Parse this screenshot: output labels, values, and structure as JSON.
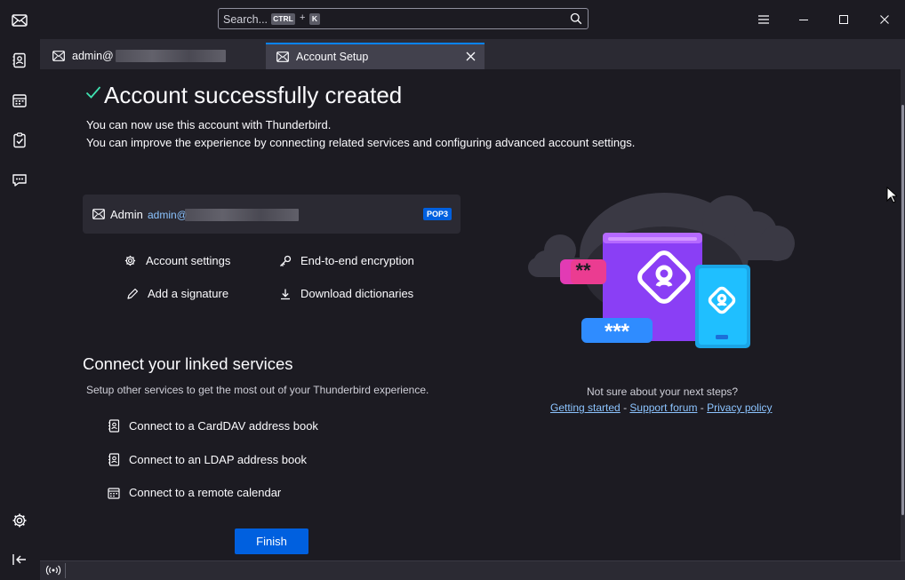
{
  "search": {
    "placeholder": "Search...",
    "key1": "CTRL",
    "plus": "+",
    "key2": "K"
  },
  "tabs": [
    {
      "label": "admin@"
    },
    {
      "label": "Account Setup"
    }
  ],
  "main": {
    "title": "Account successfully created",
    "line1": "You can now use this account with Thunderbird.",
    "line2": "You can improve the experience by connecting related services and configuring advanced account settings.",
    "account": {
      "name": "Admin",
      "email": "admin@",
      "badge": "POP3"
    },
    "actions": {
      "account_settings": "Account settings",
      "e2e": "End-to-end encryption",
      "signature": "Add a signature",
      "dictionaries": "Download dictionaries"
    },
    "linked": {
      "heading": "Connect your linked services",
      "description": "Setup other services to get the most out of your Thunderbird experience.",
      "carddav": "Connect to a CardDAV address book",
      "ldap": "Connect to an LDAP address book",
      "calendar": "Connect to a remote calendar"
    },
    "finish_label": "Finish"
  },
  "help": {
    "question": "Not sure about your next steps?",
    "getting_started": "Getting started",
    "support_forum": "Support forum",
    "privacy_policy": "Privacy policy",
    "sep": "-"
  },
  "colors": {
    "accent": "#0060df",
    "link": "#8cc4ff",
    "check": "#3fe1b0"
  }
}
